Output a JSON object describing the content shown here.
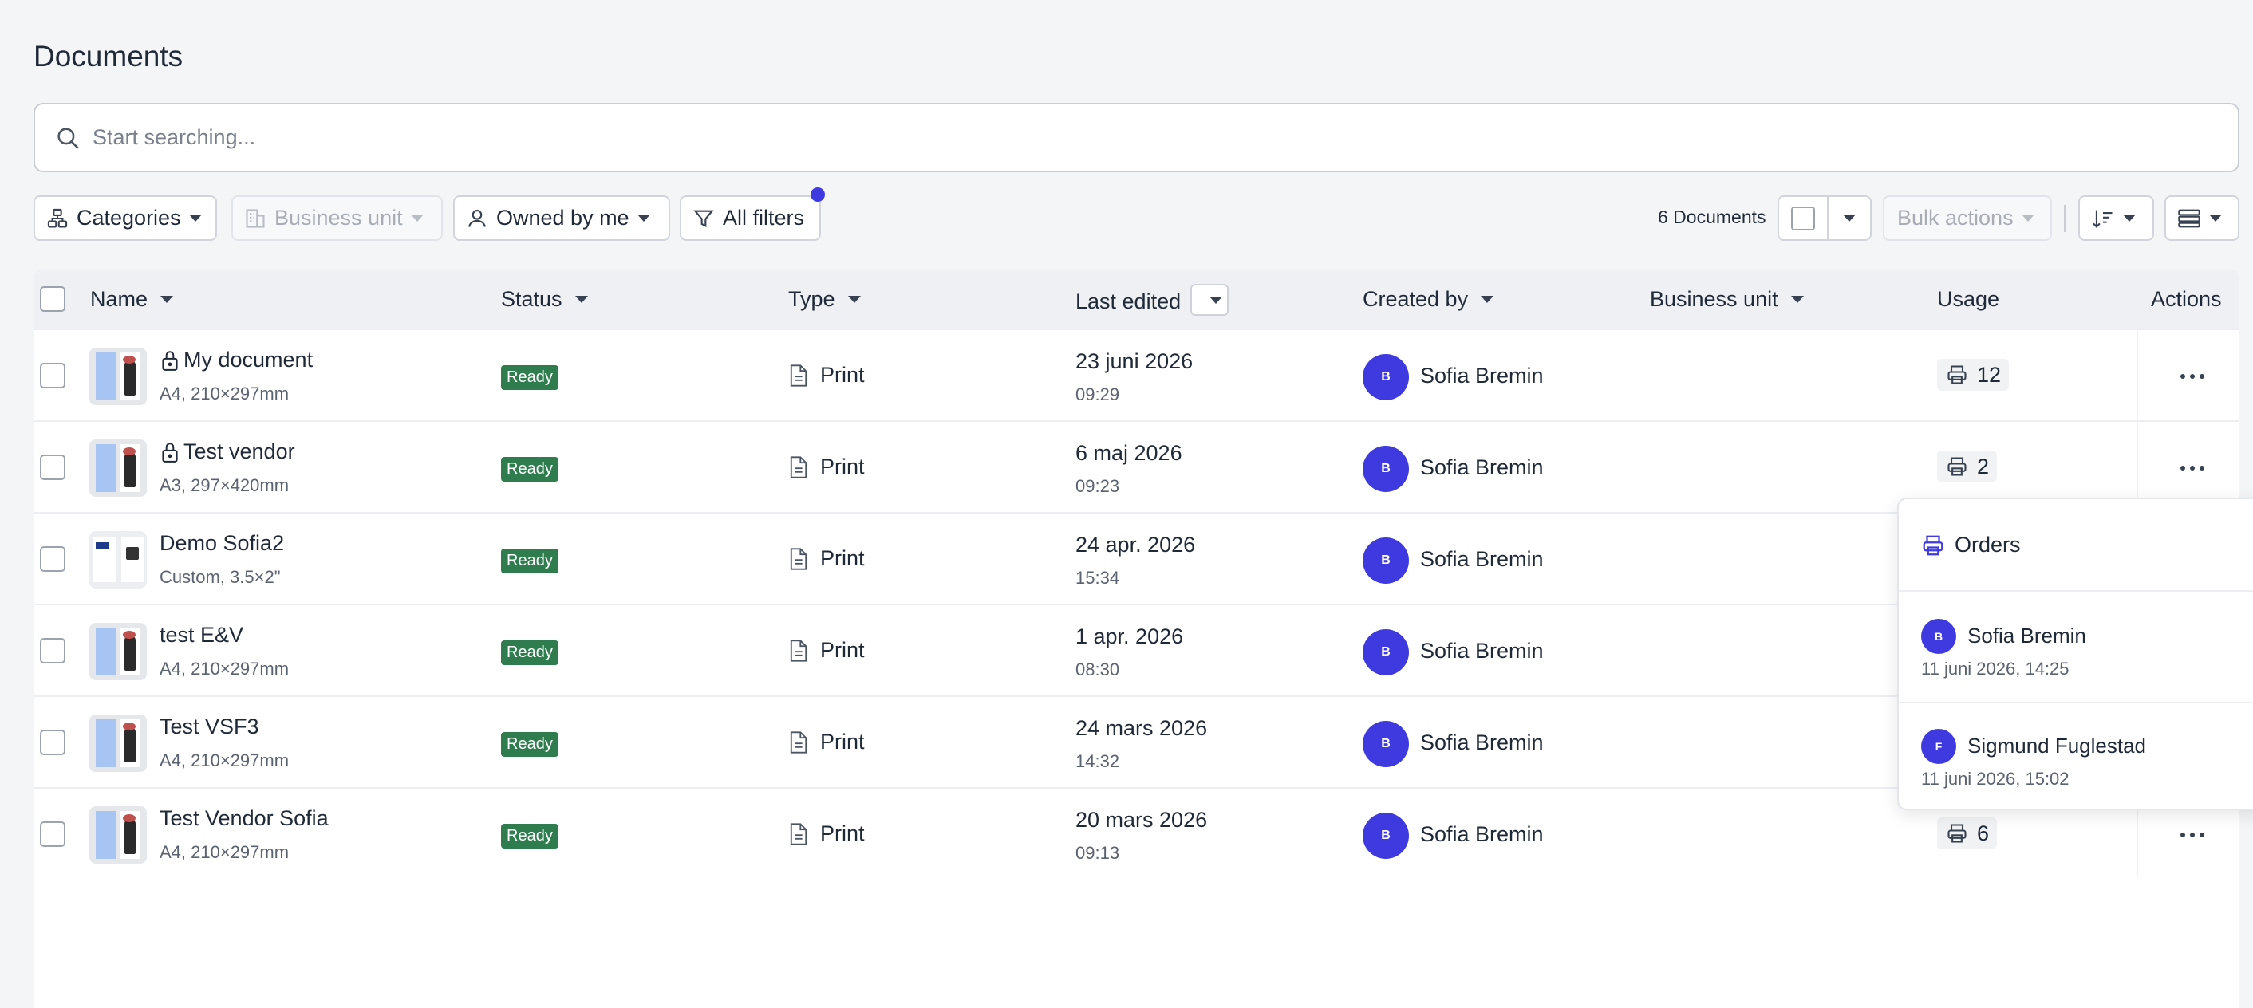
{
  "page": {
    "title": "Documents"
  },
  "search": {
    "placeholder": "Start searching..."
  },
  "toolbar": {
    "categories": "Categories",
    "business_unit": "Business unit",
    "owned_by": "Owned by me",
    "all_filters": "All filters",
    "doc_count": "6 Documents",
    "bulk_actions": "Bulk actions"
  },
  "columns": {
    "name": "Name",
    "status": "Status",
    "type": "Type",
    "last_edited": "Last edited",
    "created_by": "Created by",
    "business_unit": "Business unit",
    "usage": "Usage",
    "actions": "Actions"
  },
  "rows": [
    {
      "name": "My document",
      "locked": true,
      "size": "A4, 210×297mm",
      "status": "Ready",
      "type": "Print",
      "date": "23 juni 2026",
      "time": "09:29",
      "avatar": "B",
      "creator": "Sofia Bremin",
      "usage": "12"
    },
    {
      "name": "Test vendor",
      "locked": true,
      "size": "A3, 297×420mm",
      "status": "Ready",
      "type": "Print",
      "date": "6 maj 2026",
      "time": "09:23",
      "avatar": "B",
      "creator": "Sofia Bremin",
      "usage": "2"
    },
    {
      "name": "Demo Sofia2",
      "locked": false,
      "size": "Custom, 3.5×2\"",
      "status": "Ready",
      "type": "Print",
      "date": "24 apr. 2026",
      "time": "15:34",
      "avatar": "B",
      "creator": "Sofia Bremin",
      "usage": ""
    },
    {
      "name": "test E&V",
      "locked": false,
      "size": "A4, 210×297mm",
      "status": "Ready",
      "type": "Print",
      "date": "1 apr. 2026",
      "time": "08:30",
      "avatar": "B",
      "creator": "Sofia Bremin",
      "usage": ""
    },
    {
      "name": "Test VSF3",
      "locked": false,
      "size": "A4, 210×297mm",
      "status": "Ready",
      "type": "Print",
      "date": "24 mars 2026",
      "time": "14:32",
      "avatar": "B",
      "creator": "Sofia Bremin",
      "usage": ""
    },
    {
      "name": "Test Vendor Sofia",
      "locked": false,
      "size": "A4, 210×297mm",
      "status": "Ready",
      "type": "Print",
      "date": "20 mars 2026",
      "time": "09:13",
      "avatar": "B",
      "creator": "Sofia Bremin",
      "usage": "6"
    }
  ],
  "orders_popover": {
    "title": "Orders",
    "items": [
      {
        "avatar": "B",
        "name": "Sofia Bremin",
        "date": "11 juni 2026, 14:25"
      },
      {
        "avatar": "F",
        "name": "Sigmund Fuglestad",
        "date": "11 juni 2026, 15:02"
      }
    ]
  },
  "colors": {
    "accent": "#3f3ae0",
    "ready_badge": "#2f7d4f",
    "header_bg": "#eef0f4",
    "page_bg": "#f4f5f7"
  },
  "icons": [
    "search-icon",
    "categories-icon",
    "business-unit-icon",
    "user-icon",
    "filter-icon",
    "sort-icon",
    "view-icon",
    "lock-icon",
    "document-icon",
    "printer-icon",
    "more-icon"
  ]
}
